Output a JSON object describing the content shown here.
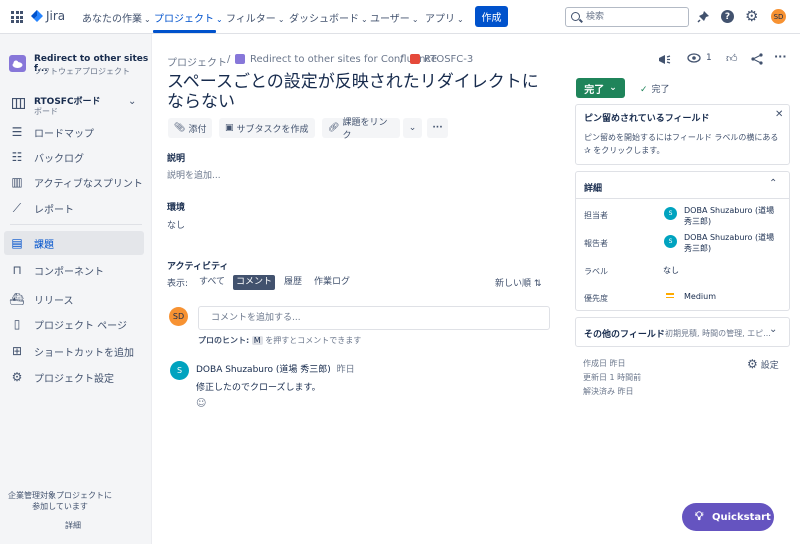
{
  "topnav": {
    "logo": "Jira",
    "items": [
      {
        "label": "あなたの作業"
      },
      {
        "label": "プロジェクト"
      },
      {
        "label": "フィルター"
      },
      {
        "label": "ダッシュボード"
      },
      {
        "label": "ユーザー"
      },
      {
        "label": "アプリ"
      }
    ],
    "create_label": "作成",
    "search_placeholder": "検索",
    "user_initials": "SD"
  },
  "sidebar": {
    "project_name": "Redirect to other sites f...",
    "project_type": "ソフトウェアプロジェクト",
    "board_name": "RTOSFCボード",
    "board_sub": "ボード",
    "items": [
      {
        "label": "ロードマップ",
        "icon": "roadmap-icon"
      },
      {
        "label": "バックログ",
        "icon": "backlog-icon"
      },
      {
        "label": "アクティブなスプリント",
        "icon": "sprint-icon"
      },
      {
        "label": "レポート",
        "icon": "reports-icon"
      },
      {
        "label": "課題",
        "icon": "issues-icon"
      },
      {
        "label": "コンポーネント",
        "icon": "components-icon"
      },
      {
        "label": "リリース",
        "icon": "releases-icon"
      },
      {
        "label": "プロジェクト ページ",
        "icon": "pages-icon"
      },
      {
        "label": "ショートカットを追加",
        "icon": "add-shortcut-icon"
      },
      {
        "label": "プロジェクト設定",
        "icon": "settings-icon"
      }
    ],
    "footer_text": "企業管理対象プロジェクトに参加しています",
    "footer_link": "詳細"
  },
  "issue": {
    "breadcrumb": [
      "プロジェクト",
      "Redirect to other sites for Confluence",
      "RTOSFC-3"
    ],
    "watch_count": "1",
    "title": "スペースごとの設定が反映されたリダイレクトにならない",
    "toolbar": {
      "attach": "添付",
      "subtask": "サブタスクを作成",
      "link": "課題をリンク"
    },
    "description_label": "説明",
    "description_placeholder": "説明を追加...",
    "environment_label": "環境",
    "environment_value": "なし",
    "activity": {
      "label": "アクティビティ",
      "show_label": "表示:",
      "filters": [
        "すべて",
        "コメント",
        "履歴",
        "作業ログ"
      ],
      "sort": "新しい順",
      "comment_placeholder": "コメントを追加する...",
      "tip_prefix": "プロのヒント:",
      "tip_key": "M",
      "tip_suffix": "を押すとコメントできます",
      "comment_author": "DOBA Shuzaburo (道場 秀三郎)",
      "comment_time": "昨日",
      "comment_body": "修正したのでクローズします。",
      "commenter_initial": "S"
    }
  },
  "right": {
    "status_btn": "完了",
    "resolution": "完了",
    "pinned_title": "ピン留めされているフィールド",
    "pinned_desc": "ピン留めを開始するにはフィールド ラベルの横にある ✰ をクリックします。",
    "details_title": "詳細",
    "fields": {
      "assignee_label": "担当者",
      "assignee": "DOBA Shuzaburo (道場 秀三郎)",
      "reporter_label": "報告者",
      "reporter": "DOBA Shuzaburo (道場 秀三郎)",
      "labels_label": "ラベル",
      "labels_value": "なし",
      "priority_label": "優先度",
      "priority_value": "Medium"
    },
    "other_fields_title": "その他のフィールド",
    "other_fields_hint": "初期見積, 時間の管理, エピ...",
    "created": "作成日 昨日",
    "updated": "更新日 1 時間前",
    "resolved": "解決済み 昨日",
    "settings": "設定"
  },
  "quickstart": "Quickstart",
  "colors": {
    "brand": "#0052CC",
    "done": "#1F845A",
    "quickstart": "#6554C0",
    "avatar_teal": "#00A3BF",
    "avatar_orange": "#F79232"
  }
}
